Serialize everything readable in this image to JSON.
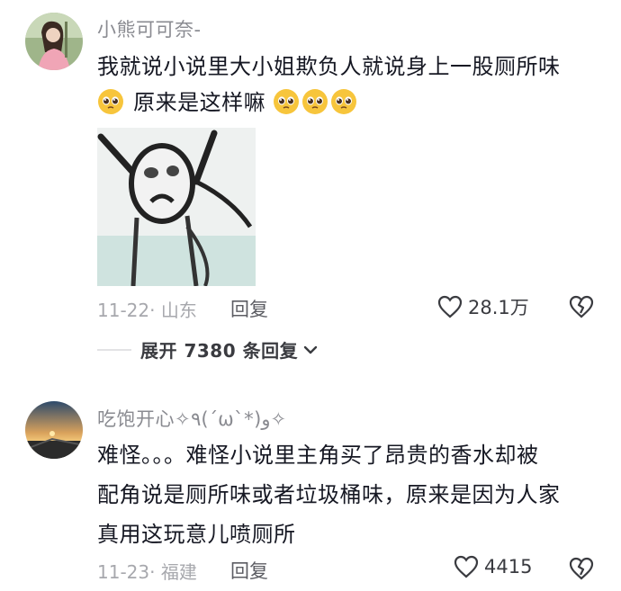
{
  "comments": [
    {
      "username": "小熊可可奈-",
      "text_line1": "我就说小说里大小姐欺负人就说身上一股厕所味",
      "text_line2": "原来是这样嘛",
      "date": "11-22",
      "location": "山东",
      "reply_label": "回复",
      "likes": "28.1万",
      "expand_label": "展开 7380 条回复"
    },
    {
      "username": "吃饱开心✧٩(ˊωˋ*)و✧",
      "text_line1": "难怪。。。难怪小说里主角买了昂贵的香水却被",
      "text_line2": "配角说是厕所味或者垃圾桶味，原来是因为人家",
      "text_line3": "真用这玩意儿喷厕所",
      "date": "11-23",
      "location": "福建",
      "reply_label": "回复",
      "likes": "4415"
    }
  ],
  "colors": {
    "text": "#161823",
    "meta": "#a7a8ad",
    "username": "#8a8b91",
    "emoji": "#f7c53c"
  },
  "icons": [
    "pleading-face-emoji",
    "heart-outline-icon",
    "broken-heart-icon",
    "chevron-down-icon"
  ]
}
